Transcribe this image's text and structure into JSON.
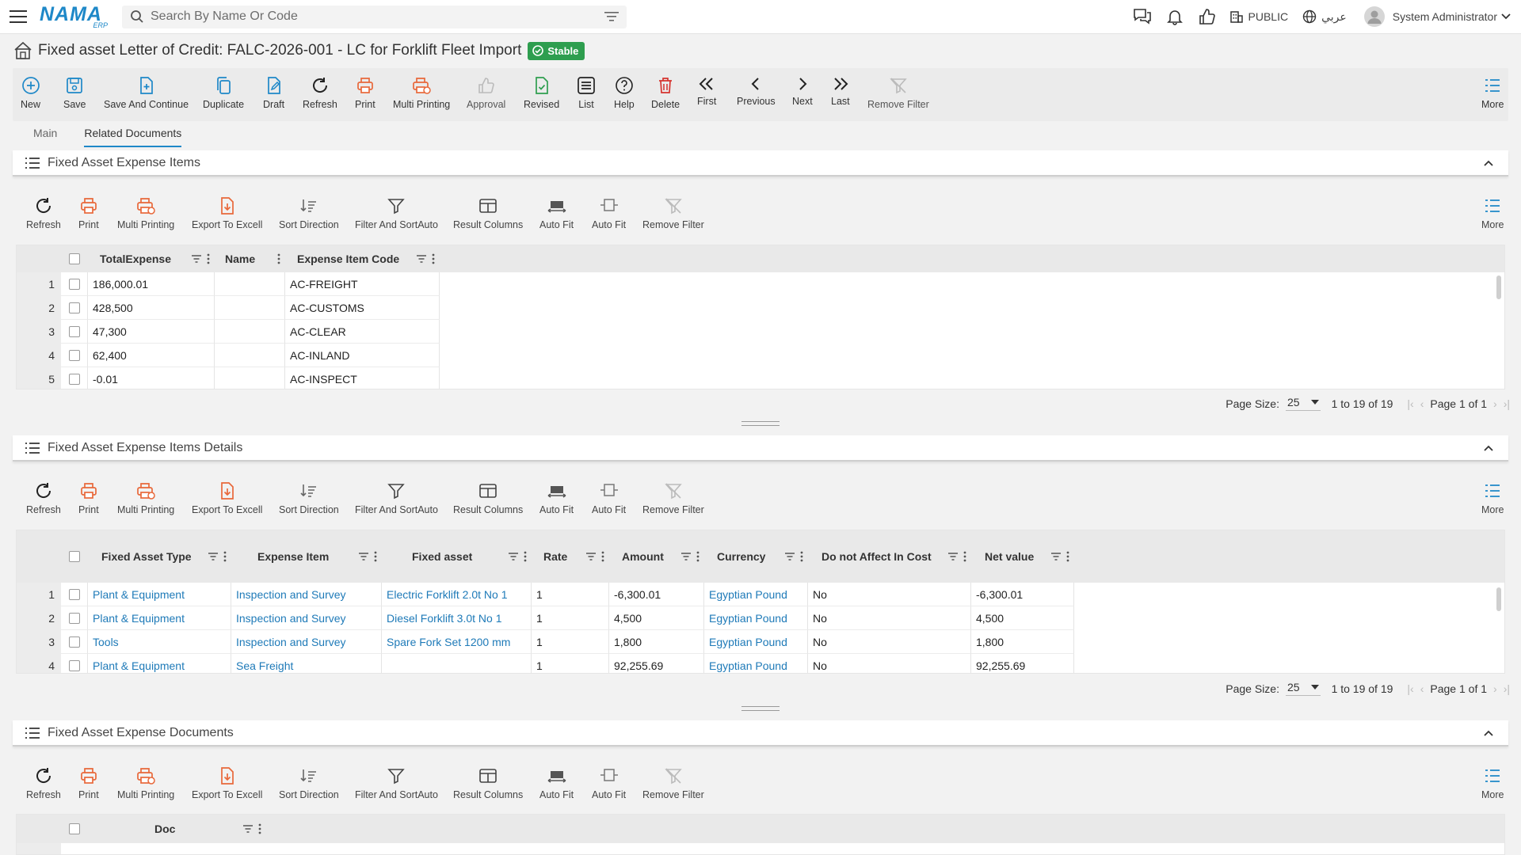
{
  "header": {
    "logo": "NAMA",
    "logo_sub": "ERP",
    "search_placeholder": "Search By Name Or Code",
    "public_label": "PUBLIC",
    "language_label": "عربي",
    "user_name": "System Administrator"
  },
  "title": {
    "text": "Fixed asset Letter of Credit: FALC-2026-001 - LC for Forklift Fleet Import",
    "status": "Stable"
  },
  "toolbar": {
    "new": "New",
    "save": "Save",
    "save_continue": "Save And Continue",
    "duplicate": "Duplicate",
    "draft": "Draft",
    "refresh": "Refresh",
    "print": "Print",
    "multi_printing": "Multi Printing",
    "approval": "Approval",
    "revised": "Revised",
    "list": "List",
    "help": "Help",
    "delete": "Delete",
    "first": "First",
    "previous": "Previous",
    "next": "Next",
    "last": "Last",
    "remove_filter": "Remove Filter",
    "more": "More"
  },
  "tabs": {
    "main": "Main",
    "related": "Related Documents"
  },
  "grid_toolbar": {
    "refresh": "Refresh",
    "print": "Print",
    "multi_printing": "Multi Printing",
    "export": "Export To Excell",
    "sort": "Sort Direction",
    "filter": "Filter And SortAuto",
    "columns": "Result Columns",
    "autofit1": "Auto Fit",
    "autofit2": "Auto Fit",
    "remove_filter": "Remove Filter",
    "more": "More"
  },
  "pager": {
    "page_size_label": "Page Size:",
    "page_size": "25",
    "range": "1 to 19 of 19",
    "page": "Page 1 of 1"
  },
  "section1": {
    "title": "Fixed Asset Expense Items",
    "columns": [
      "TotalExpense",
      "Name",
      "Expense Item Code"
    ],
    "rows": [
      {
        "n": "1",
        "total": "186,000.01",
        "name": "",
        "code": "AC-FREIGHT"
      },
      {
        "n": "2",
        "total": "428,500",
        "name": "",
        "code": "AC-CUSTOMS"
      },
      {
        "n": "3",
        "total": "47,300",
        "name": "",
        "code": "AC-CLEAR"
      },
      {
        "n": "4",
        "total": "62,400",
        "name": "",
        "code": "AC-INLAND"
      },
      {
        "n": "5",
        "total": "-0.01",
        "name": "",
        "code": "AC-INSPECT"
      }
    ]
  },
  "section2": {
    "title": "Fixed Asset Expense Items Details",
    "columns": [
      "Fixed Asset Type",
      "Expense Item",
      "Fixed asset",
      "Rate",
      "Amount",
      "Currency",
      "Do not Affect In Cost",
      "Net value"
    ],
    "rows": [
      {
        "n": "1",
        "type": "Plant & Equipment",
        "item": "Inspection and Survey",
        "asset": "Electric Forklift 2.0t No 1",
        "rate": "1",
        "amount": "-6,300.01",
        "currency": "Egyptian Pound",
        "noaffect": "No",
        "net": "-6,300.01"
      },
      {
        "n": "2",
        "type": "Plant & Equipment",
        "item": "Inspection and Survey",
        "asset": "Diesel Forklift 3.0t No 1",
        "rate": "1",
        "amount": "4,500",
        "currency": "Egyptian Pound",
        "noaffect": "No",
        "net": "4,500"
      },
      {
        "n": "3",
        "type": "Tools",
        "item": "Inspection and Survey",
        "asset": "Spare Fork Set 1200 mm",
        "rate": "1",
        "amount": "1,800",
        "currency": "Egyptian Pound",
        "noaffect": "No",
        "net": "1,800"
      },
      {
        "n": "4",
        "type": "Plant & Equipment",
        "item": "Sea Freight",
        "asset": "",
        "rate": "1",
        "amount": "92,255.69",
        "currency": "Egyptian Pound",
        "noaffect": "No",
        "net": "92,255.69"
      }
    ]
  },
  "section3": {
    "title": "Fixed Asset Expense Documents",
    "columns": [
      "Doc"
    ]
  }
}
